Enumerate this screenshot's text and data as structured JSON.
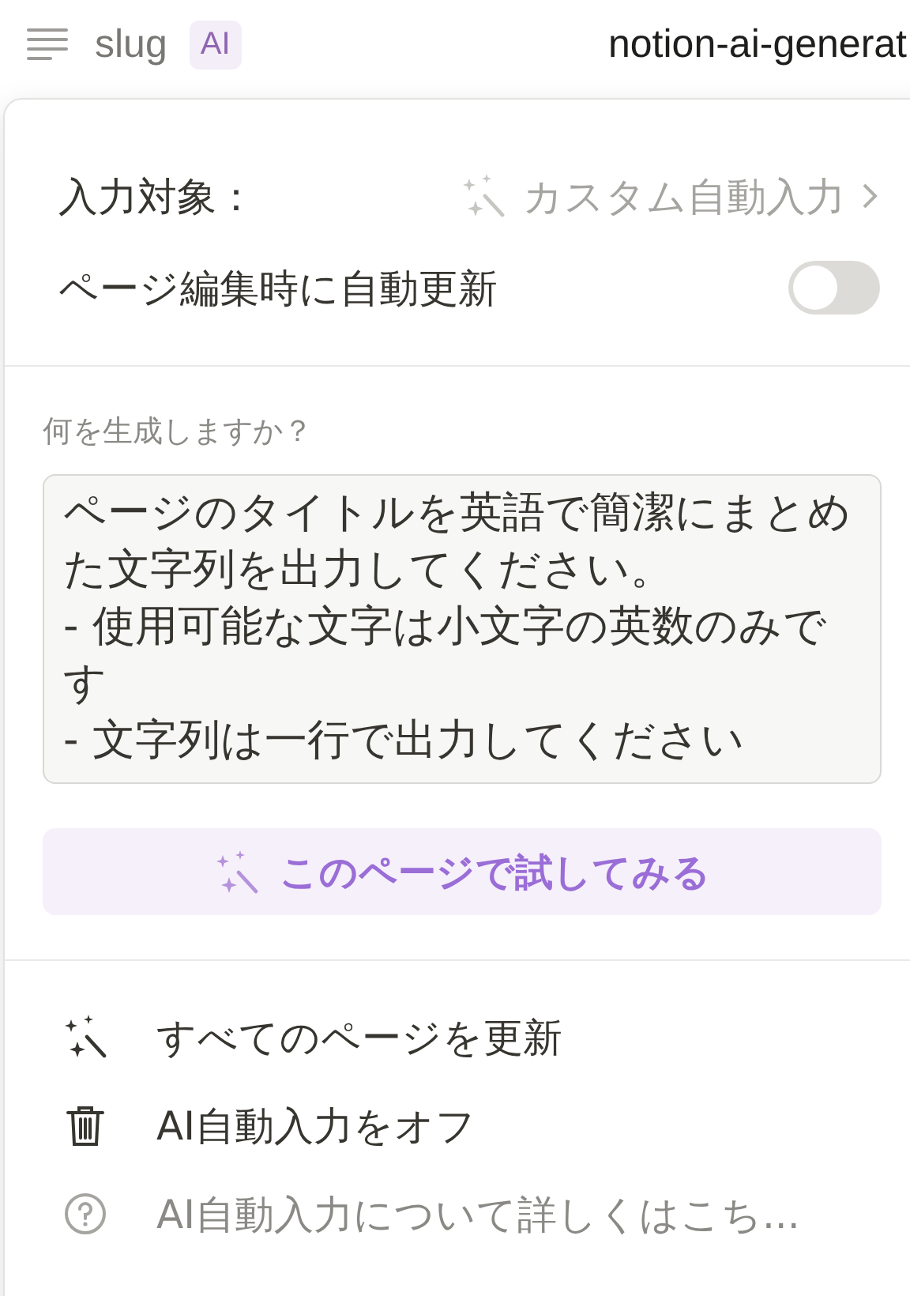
{
  "top_bar": {
    "property_name": "slug",
    "badge": "AI",
    "page_title": "notion-ai-generat"
  },
  "settings": {
    "target_label": "入力対象：",
    "target_value": "カスタム自動入力",
    "auto_update_label": "ページ編集時に自動更新",
    "auto_update_on": false
  },
  "prompt": {
    "label": "何を生成しますか？",
    "value": "ページのタイトルを英語で簡潔にまとめた文字列を出力してください。\n- 使用可能な文字は小文字の英数のみです\n- 文字列は一行で出力してください"
  },
  "try_button": "このページで試してみる",
  "menu": [
    {
      "kind": "update",
      "label": "すべてのページを更新"
    },
    {
      "kind": "delete",
      "label": "AI自動入力をオフ"
    },
    {
      "kind": "help",
      "label": "AI自動入力について詳しくはこち..."
    }
  ]
}
